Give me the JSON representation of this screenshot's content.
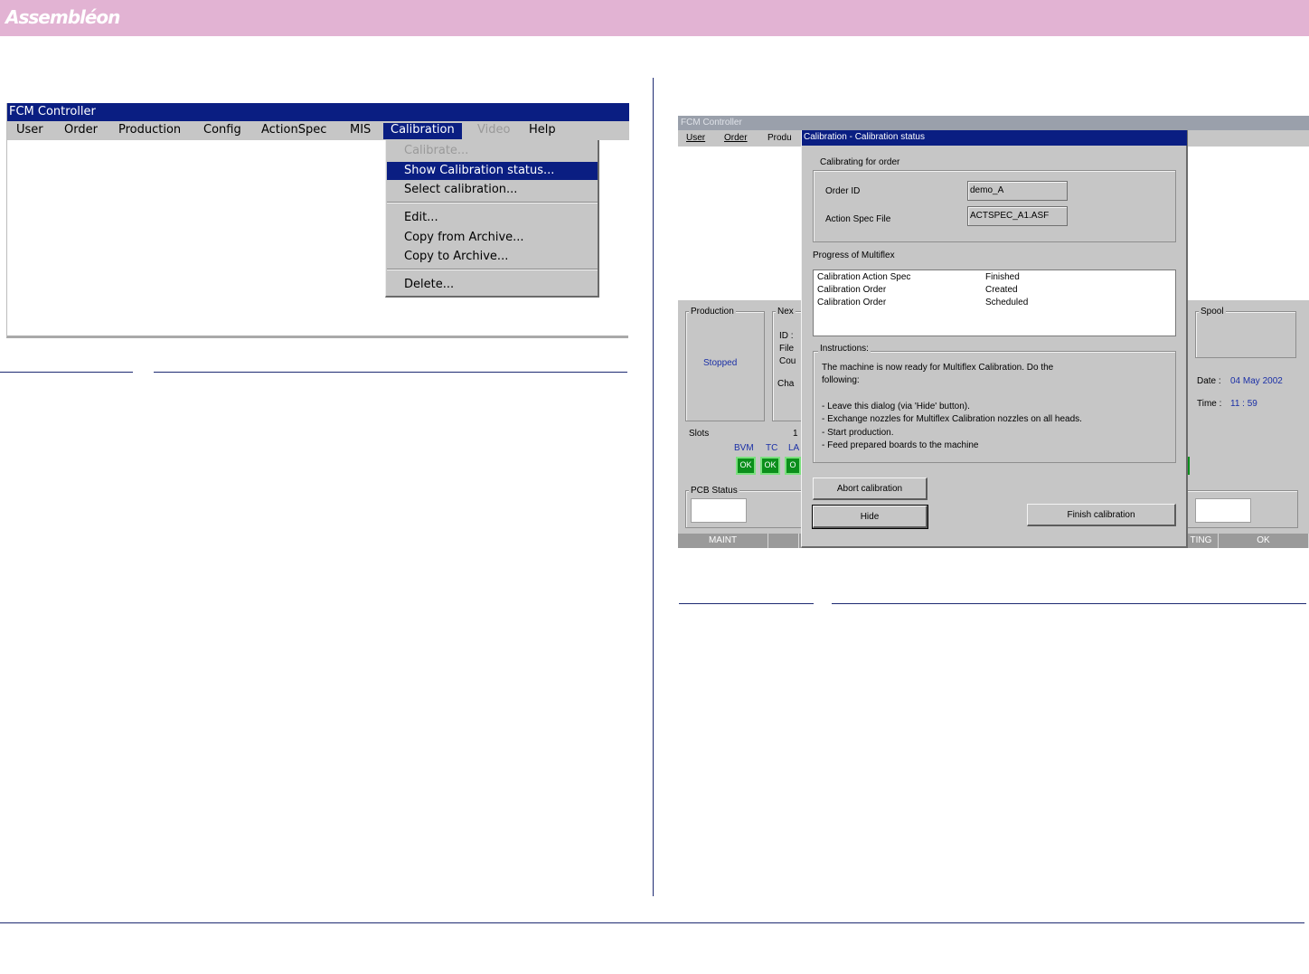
{
  "brand": {
    "logo_text": "Assembléon"
  },
  "left_screenshot": {
    "window_title": "FCM Controller",
    "menus": [
      {
        "label": "User"
      },
      {
        "label": "Order"
      },
      {
        "label": "Production"
      },
      {
        "label": "Config"
      },
      {
        "label": "ActionSpec"
      },
      {
        "label": "MIS"
      },
      {
        "label": "Calibration",
        "state": "open"
      },
      {
        "label": "Video",
        "state": "disabled"
      },
      {
        "label": "Help"
      }
    ],
    "calibration_menu": [
      {
        "label": "Calibrate...",
        "state": "disabled"
      },
      {
        "label": "Show Calibration status...",
        "state": "selected"
      },
      {
        "label": "Select calibration..."
      },
      {
        "label": "Edit..."
      },
      {
        "label": "Copy from Archive..."
      },
      {
        "label": "Copy to Archive..."
      },
      {
        "label": "Delete..."
      }
    ]
  },
  "right_screenshot": {
    "background_window": {
      "title": "FCM Controller",
      "menus": [
        "User",
        "Order",
        "Produ"
      ],
      "production_frame_label": "Production",
      "production_state": "Stopped",
      "next_frame_label": "Nex",
      "next_fields": [
        "ID :",
        "File",
        "Cou",
        "Cha"
      ],
      "speed_frame_label": "Spool",
      "date_label": "Date :",
      "date_value": "04 May 2002",
      "time_label": "Time :",
      "time_value": "11 : 59",
      "slots_label": "Slots",
      "slots_number": "1",
      "slot_headers": [
        "BVM",
        "TC",
        "LA"
      ],
      "slot_status": [
        "OK",
        "OK",
        "O"
      ],
      "pcb_status_label": "PCB Status",
      "status_bar": [
        "MAINT",
        "TING",
        "OK"
      ]
    },
    "dialog": {
      "title": "Calibration - Calibration status",
      "group_label": "Calibrating for order",
      "order_id_label": "Order ID",
      "order_id_value": "demo_A",
      "action_spec_label": "Action Spec File",
      "action_spec_value": "ACTSPEC_A1.ASF",
      "progress_label": "Progress of Multiflex",
      "progress_rows": [
        {
          "item": "Calibration Action Spec",
          "status": "Finished"
        },
        {
          "item": "Calibration Order",
          "status": "Created"
        },
        {
          "item": "Calibration Order",
          "status": "Scheduled"
        }
      ],
      "instructions_label": "Instructions:",
      "instructions_intro_1": "The machine is now ready for Multiflex Calibration. Do the",
      "instructions_intro_2": "following:",
      "instructions_steps": [
        "- Leave this dialog (via 'Hide' button).",
        "- Exchange nozzles for Multiflex Calibration nozzles on all heads.",
        "- Start production.",
        "- Feed prepared boards to the machine"
      ],
      "abort_button": "Abort calibration",
      "hide_button": "Hide",
      "finish_button": "Finish calibration"
    }
  }
}
